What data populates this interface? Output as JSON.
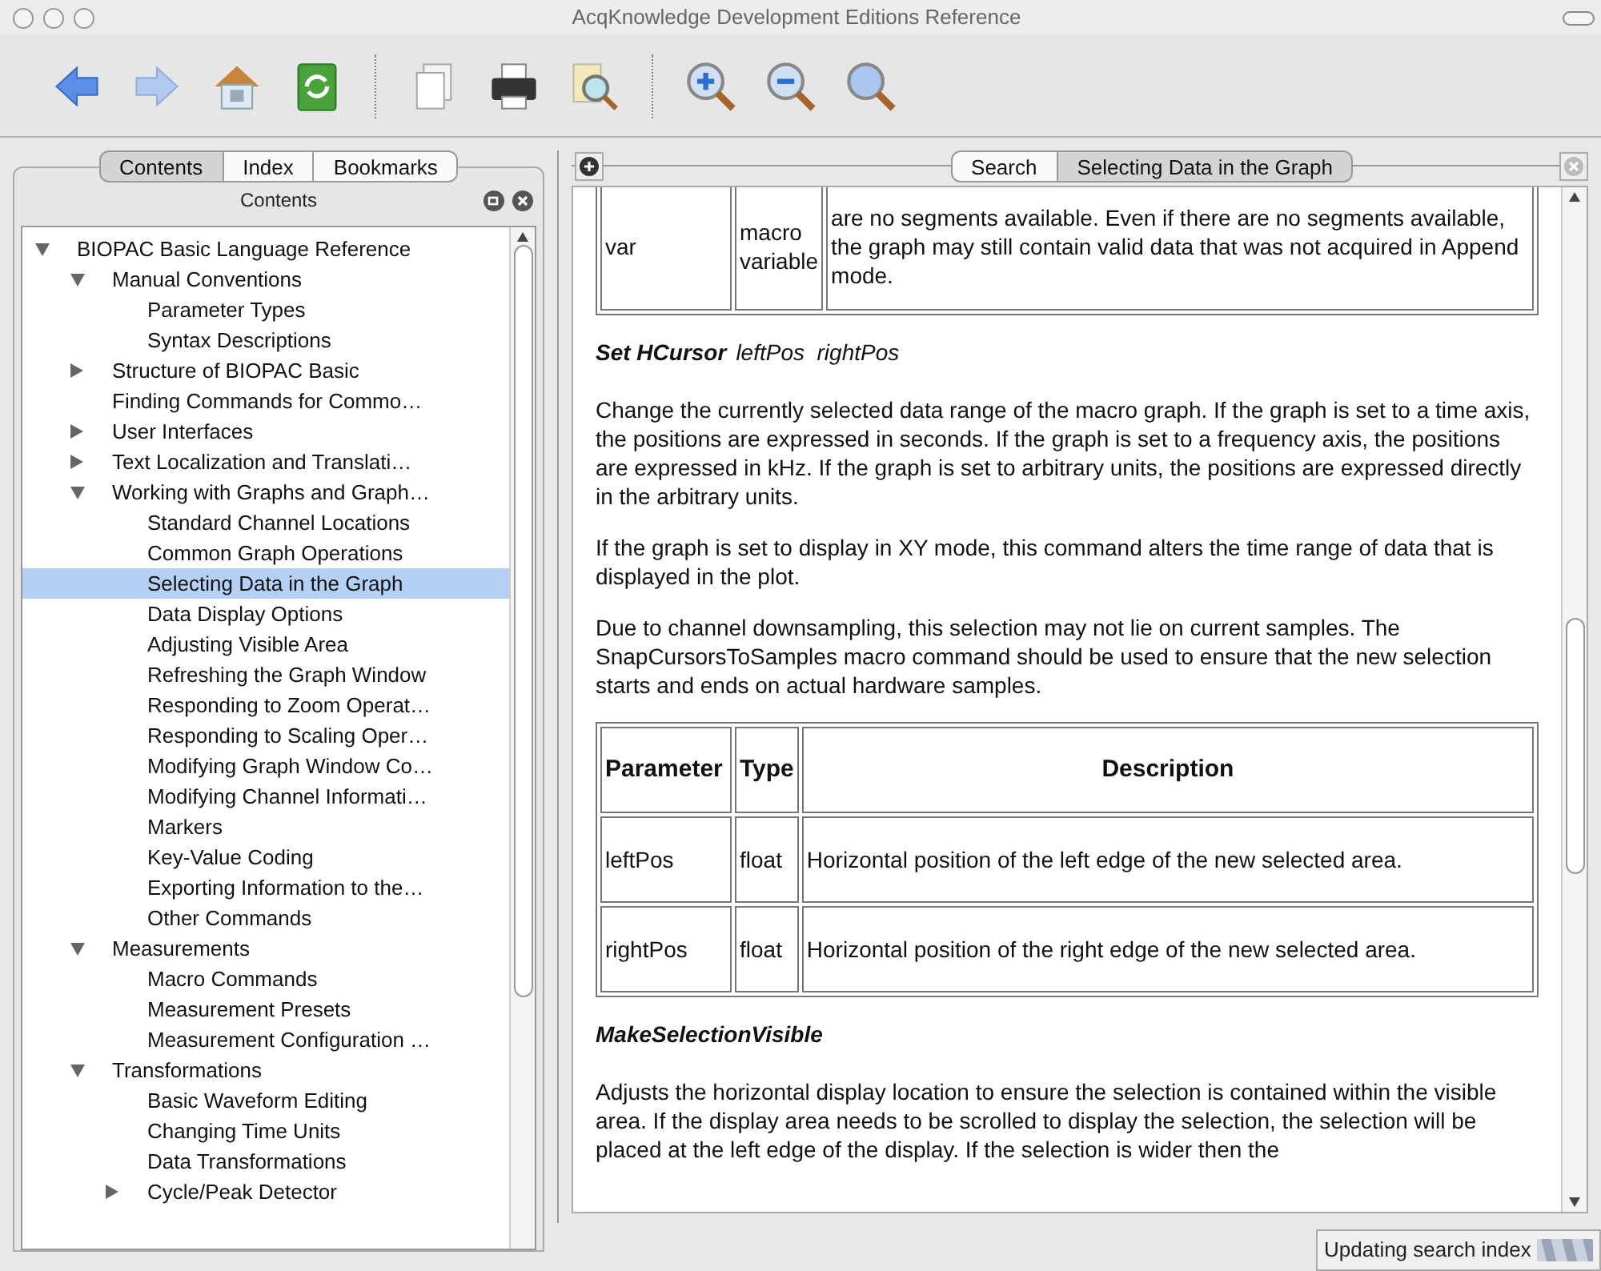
{
  "window": {
    "title": "AcqKnowledge Development Editions Reference"
  },
  "toolbar": [
    {
      "kind": "back"
    },
    {
      "kind": "forward"
    },
    {
      "kind": "home"
    },
    {
      "kind": "refresh"
    },
    {
      "kind": "separator"
    },
    {
      "kind": "pages"
    },
    {
      "kind": "print"
    },
    {
      "kind": "preview"
    },
    {
      "kind": "separator"
    },
    {
      "kind": "zoom_in"
    },
    {
      "kind": "zoom_out"
    },
    {
      "kind": "zoom_reset"
    }
  ],
  "sidebar": {
    "tabs": [
      {
        "label": "Contents",
        "selected": true
      },
      {
        "label": "Index",
        "selected": false
      },
      {
        "label": "Bookmarks",
        "selected": false
      }
    ],
    "header": "Contents",
    "tree": [
      {
        "label": "BIOPAC Basic Language Reference",
        "expanded": true,
        "children": [
          {
            "label": "Manual Conventions",
            "expanded": true,
            "children": [
              {
                "label": "Parameter Types"
              },
              {
                "label": "Syntax Descriptions"
              }
            ]
          },
          {
            "label": "Structure of BIOPAC Basic",
            "expanded": false
          },
          {
            "label": "Finding Commands for Commo…"
          },
          {
            "label": "User Interfaces",
            "expanded": false
          },
          {
            "label": "Text Localization and Translati…",
            "expanded": false
          },
          {
            "label": "Working with Graphs and Graph…",
            "expanded": true,
            "children": [
              {
                "label": "Standard Channel Locations"
              },
              {
                "label": "Common Graph Operations"
              },
              {
                "label": "Selecting Data in the Graph",
                "selected": true
              },
              {
                "label": "Data Display Options"
              },
              {
                "label": "Adjusting Visible Area"
              },
              {
                "label": "Refreshing the Graph Window"
              },
              {
                "label": "Responding to Zoom Operat…"
              },
              {
                "label": "Responding to Scaling Oper…"
              },
              {
                "label": "Modifying Graph Window Co…"
              },
              {
                "label": "Modifying Channel Informati…"
              },
              {
                "label": "Markers"
              },
              {
                "label": "Key-Value Coding"
              },
              {
                "label": "Exporting Information to the…"
              },
              {
                "label": "Other Commands"
              }
            ]
          },
          {
            "label": "Measurements",
            "expanded": true,
            "children": [
              {
                "label": "Macro Commands"
              },
              {
                "label": "Measurement Presets"
              },
              {
                "label": "Measurement Configuration …"
              }
            ]
          },
          {
            "label": "Transformations",
            "expanded": true,
            "children": [
              {
                "label": "Basic Waveform Editing"
              },
              {
                "label": "Changing Time Units"
              },
              {
                "label": "Data Transformations"
              },
              {
                "label": "Cycle/Peak Detector",
                "expanded": false
              }
            ]
          }
        ]
      }
    ]
  },
  "content": {
    "tabs": [
      {
        "label": "Search",
        "selected": false
      },
      {
        "label": "Selecting Data in the Graph",
        "selected": true
      }
    ],
    "blocks": [
      {
        "kind": "table",
        "rows": [
          [
            "var",
            "macro variable",
            "are no segments available. Even if there are no segments available, the graph may still contain valid data that was not acquired in Append mode."
          ]
        ]
      },
      {
        "kind": "heading",
        "command": "Set HCursor",
        "params": "leftPos  rightPos"
      },
      {
        "kind": "paragraph",
        "text": "Change the currently selected data range of the macro graph. If the graph is set to a time axis, the positions are expressed in seconds. If the graph is set to a frequency axis, the positions are expressed in kHz. If the graph is set to arbitrary units, the positions are expressed directly in the arbitrary units."
      },
      {
        "kind": "paragraph",
        "text": "If the graph is set to display in XY mode, this command alters the time range of data that is displayed in the plot."
      },
      {
        "kind": "paragraph",
        "text": "Due to channel downsampling, this selection may not lie on current samples. The SnapCursorsToSamples macro command should be used to ensure that the new selection starts and ends on actual hardware samples."
      },
      {
        "kind": "table",
        "columns": [
          "Parameter",
          "Type",
          "Description"
        ],
        "rows": [
          [
            "leftPos",
            "float",
            "Horizontal position of the left edge of the new selected area."
          ],
          [
            "rightPos",
            "float",
            "Horizontal position of the right edge of the new selected area."
          ]
        ]
      },
      {
        "kind": "heading",
        "command": "MakeSelectionVisible"
      },
      {
        "kind": "paragraph",
        "text": "Adjusts the horizontal display location to ensure the selection is contained within the visible area. If the display area needs to be scrolled to display the selection, the selection will be placed at the left edge of the display. If the selection is wider then the"
      }
    ]
  },
  "status_bar": {
    "text": "Updating search index"
  }
}
